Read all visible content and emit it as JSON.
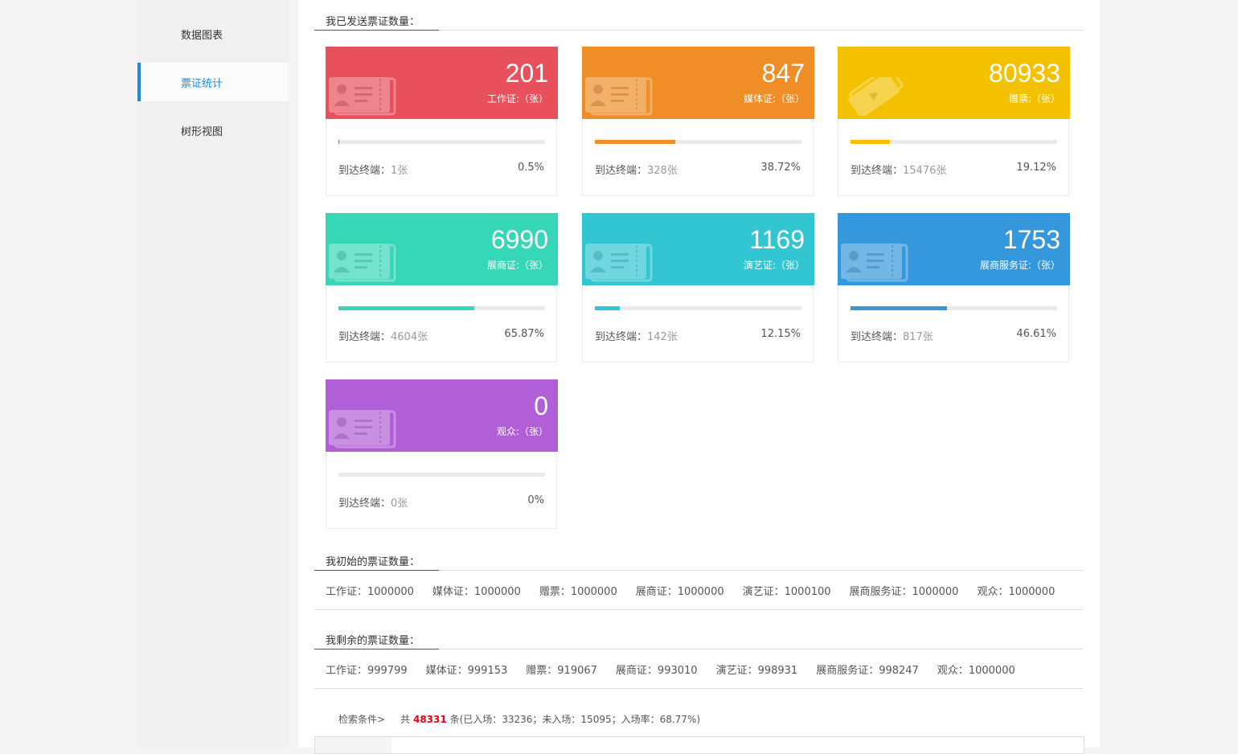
{
  "sidebar": {
    "items": [
      {
        "label": "数据图表"
      },
      {
        "label": "票证统计"
      },
      {
        "label": "树形视图"
      }
    ]
  },
  "sections": {
    "sent_title": "我已发送票证数量：",
    "initial_title": "我初始的票证数量：",
    "remaining_title": "我剩余的票证数量："
  },
  "cards": [
    {
      "number": "201",
      "label": "工作证:（张）",
      "arrived_label": "到达终端：",
      "arrived_value": "1张",
      "percent": "0.5%",
      "progress": 0.005,
      "color": "#e8505b",
      "icon": "id-card-icon"
    },
    {
      "number": "847",
      "label": "媒体证:（张）",
      "arrived_label": "到达终端：",
      "arrived_value": "328张",
      "percent": "38.72%",
      "progress": 0.3872,
      "color": "#ef8e26",
      "icon": "id-card-icon"
    },
    {
      "number": "80933",
      "label": "赠票:（张）",
      "arrived_label": "到达终端：",
      "arrived_value": "15476张",
      "percent": "19.12%",
      "progress": 0.1912,
      "color": "#f3c100",
      "icon": "ticket-icon"
    },
    {
      "number": "6990",
      "label": "展商证:（张）",
      "arrived_label": "到达终端：",
      "arrived_value": "4604张",
      "percent": "65.87%",
      "progress": 0.6587,
      "color": "#36d7b7",
      "icon": "id-card-icon"
    },
    {
      "number": "1169",
      "label": "演艺证:（张）",
      "arrived_label": "到达终端：",
      "arrived_value": "142张",
      "percent": "12.15%",
      "progress": 0.1215,
      "color": "#32c5d2",
      "icon": "id-card-icon"
    },
    {
      "number": "1753",
      "label": "展商服务证:（张）",
      "arrived_label": "到达终端：",
      "arrived_value": "817张",
      "percent": "46.61%",
      "progress": 0.4661,
      "color": "#3598dc",
      "icon": "id-card-icon"
    },
    {
      "number": "0",
      "label": "观众:（张）",
      "arrived_label": "到达终端：",
      "arrived_value": "0张",
      "percent": "0%",
      "progress": 0,
      "color": "#b05fd6",
      "icon": "id-card-icon"
    }
  ],
  "initial": [
    "工作证：1000000",
    "媒体证：1000000",
    "赠票：1000000",
    "展商证：1000000",
    "演艺证：1000100",
    "展商服务证：1000000",
    "观众：1000000"
  ],
  "remaining": [
    "工作证：999799",
    "媒体证：999153",
    "赠票：919067",
    "展商证：993010",
    "演艺证：998931",
    "展商服务证：998247",
    "观众：1000000"
  ],
  "search": {
    "label": "检索条件>",
    "prefix": "共",
    "total": "48331",
    "suffix": "条(已入场：33236；未入场：15095；入场率：68.77%)"
  }
}
